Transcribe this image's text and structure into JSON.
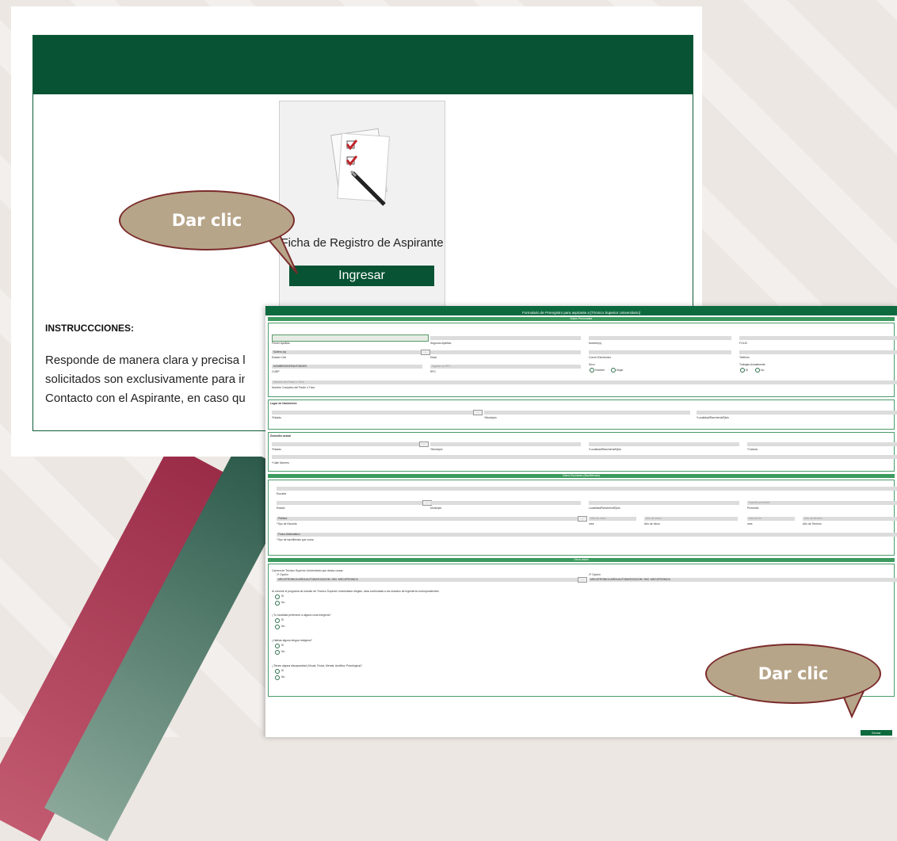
{
  "shot1": {
    "card_title": "Ficha de Registro de Aspirante",
    "card_button": "Ingresar",
    "instructions_heading": "INSTRUCCCIONES:",
    "instructions_lines": [
      "Responde de manera clara y precisa l",
      "solicitados son exclusivamente para in",
      "Contacto con el Aspirante, en caso que s"
    ]
  },
  "bubbles": {
    "first": "Dar clic",
    "second": "Dar clic"
  },
  "form": {
    "title": "Formulario de Preregistro para aspirante a [Técnico Superior Universitario]",
    "sections": {
      "personal": "Datos Personales",
      "birth": "Lugar de Nacimiento",
      "address": "Domicilio actual",
      "studies": "Datos Escolares (Bachillerato)",
      "other": "Otros datos"
    },
    "labels": {
      "primer_apellido": "Primer Apellido",
      "segundo_apellido": "Segundo Apellido",
      "nombre": "Nombre(s)",
      "folio": "FOLIO",
      "estado_civil": "Estado Civil",
      "estado_civil_value": "Soltero (a)",
      "edad": "Edad",
      "correo": "Correo Electrónico",
      "telefono": "Teléfono",
      "curp_value": "NOMBRESDEPANTOBSES",
      "curp": "CURP",
      "rfc_placeholder": "Ingrese su RFC",
      "rfc": "RFC",
      "sexo": "Sexo",
      "hombre": "Hombre",
      "mujer": "Mujer",
      "trabaja": "Trabajas Actualmente",
      "si": "Si",
      "no": "No",
      "tutor_placeholder": "Nombre del Padre o Tutor",
      "tutor": "Nombre Completo del Padre o Tutor",
      "estado": "*Estado",
      "municipio": "*Municipio",
      "localidad": "*Localidad/Ranchería/Ejido",
      "colonia": "*Colonia",
      "calle": "*Calle Número",
      "escuela": "Escuela",
      "estado2": "Estado",
      "municipio2": "Municipio",
      "localidad2": "Localidad/Ranchería/Ejido",
      "promedio_placeholder": "Ingrese promedio",
      "promedio": "Promedio",
      "tipo_escuela_value": "Pública",
      "tipo_escuela": "*Tipo de Escuela",
      "mes_inicio": "Mes de inicio",
      "anio_inicio": "Año de inicio",
      "mes_fin": "Mes de fin",
      "anio_termino": "Año de termino",
      "mes": "mes",
      "anio_de_inicio": "Año de Inicio",
      "anio_de_termino": "Año de Termino",
      "bachillerato_value": "Físico-Matemático",
      "bachillerato": "*Tipo de bachillerato que cursa",
      "carrera_q": "Carrera de Técnico Superior Universitario que desea cursar:",
      "opcion1": "1ª Opción",
      "opcion2": "2ª Opción",
      "carrera_value": "MECATRONICA AREA AUTOMATIZACION / ING. MECATRONICA",
      "q_continuidad": "Al concluir el programa de estudio de Técnico Superior Universitario elegido, dará continuidad a los estudios de Ingeniería correspondientes:",
      "q_indigena": "¿Tu localidad pertenece a alguna zona Indígena?",
      "q_lengua": "¿Hablas alguna lengua Indígena?",
      "q_discapacidad": "¿Tienes alguna discapacidad (Visual, Física, Mental, Auditiva, Psicológica)?",
      "enviar": "Enviar"
    }
  },
  "colors": {
    "brand_green": "#075333",
    "section_green": "#3c9a5e",
    "bubble_fill": "#b7a589",
    "bubble_border": "#7b2b2b"
  }
}
